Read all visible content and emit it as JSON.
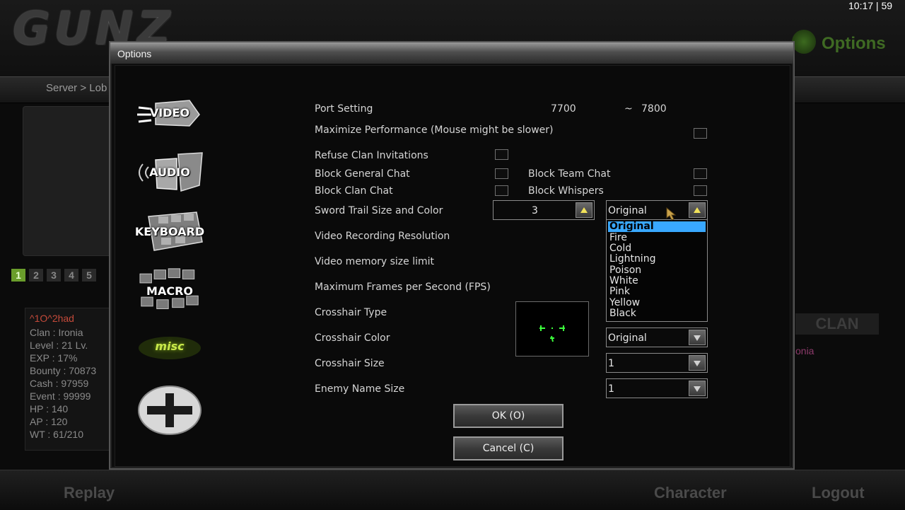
{
  "background": {
    "game_logo": "GUNZ",
    "clock": "10:17 |  59",
    "header_title": "Options",
    "breadcrumb": "Server > Lob",
    "page_numbers": [
      "1",
      "2",
      "3",
      "4",
      "5"
    ],
    "player": {
      "name": "^1O^2had",
      "stats": [
        "Clan : Ironia",
        "Level : 21 Lv.",
        "EXP : 17%",
        "Bounty : 70873",
        "Cash : 97959",
        "Event : 99999",
        "HP : 140",
        "AP : 120",
        "WT : 61/210"
      ]
    },
    "clan_button": "CLAN",
    "clan_name": "onia",
    "bottom_nav": {
      "replay": "Replay",
      "character": "Character",
      "logout": "Logout"
    }
  },
  "dialog": {
    "title": "Options",
    "categories": [
      {
        "label": "VIDEO",
        "icon": "video-camera-icon"
      },
      {
        "label": "AUDIO",
        "icon": "speaker-icon"
      },
      {
        "label": "KEYBOARD",
        "icon": "keyboard-icon"
      },
      {
        "label": "MACRO",
        "icon": "macro-keys-icon"
      },
      {
        "label": "misc",
        "icon": "misc-icon"
      },
      {
        "label": "",
        "icon": "plus-icon"
      }
    ],
    "options": {
      "port_label": "Port Setting",
      "port_from": "7700",
      "port_sep": "~",
      "port_to": "7800",
      "maximize_label": "Maximize Performance (Mouse might be slower)",
      "refuse_clan_label": "Refuse Clan Invitations",
      "block_general_label": "Block General Chat",
      "block_team_label": "Block Team Chat",
      "block_clan_label": "Block Clan Chat",
      "block_whispers_label": "Block Whispers",
      "sword_trail_label": "Sword Trail Size and Color",
      "sword_trail_size": "3",
      "sword_trail_color": "Original",
      "video_rec_label": "Video Recording Resolution",
      "video_mem_label": "Video memory size limit",
      "max_fps_label": "Maximum Frames per Second (FPS)",
      "crosshair_type_label": "Crosshair Type",
      "crosshair_color_label": "Crosshair Color",
      "crosshair_color": "Original",
      "crosshair_size_label": "Crosshair Size",
      "crosshair_size": "1",
      "enemy_name_label": "Enemy Name Size",
      "enemy_name_size": "1"
    },
    "color_dropdown_options": [
      "Original",
      "Fire",
      "Cold",
      "Lightning",
      "Poison",
      "White",
      "Pink",
      "Yellow",
      "Black"
    ],
    "ok_label": "OK (O)",
    "cancel_label": "Cancel (C)"
  },
  "colors": {
    "accent_highlight": "#39a8ff",
    "crosshair": "#3cff3c",
    "arrow": "#f2e35a"
  }
}
